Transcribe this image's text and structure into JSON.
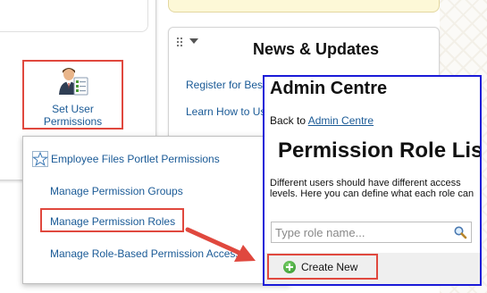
{
  "tile": {
    "label_line1": "Set User",
    "label_line2": "Permissions",
    "icon": "admin-user-icon"
  },
  "news": {
    "title": "News & Updates",
    "links": [
      "Register for Bes",
      "Learn How to Us"
    ]
  },
  "popup": {
    "items": [
      "Employee Files Portlet Permissions",
      "Manage Permission Groups",
      "Manage Permission Roles",
      "Manage Role-Based Permission Access"
    ],
    "star_icon": "favorite-star-icon"
  },
  "admin": {
    "title": "Admin Centre",
    "back_prefix": "Back to ",
    "back_link": "Admin Centre",
    "heading": "Permission Role Lis",
    "description": "Different users should have different access levels. Here you can define what each role can access.",
    "search_placeholder": "Type role name...",
    "search_icon": "search-icon",
    "create_label": "Create New",
    "create_icon": "plus-circle-icon"
  },
  "colors": {
    "highlight": "#e0483e",
    "admin_border": "#1a1ad8",
    "link": "#1a5a96",
    "yellow_card": "#fdf8d7"
  }
}
